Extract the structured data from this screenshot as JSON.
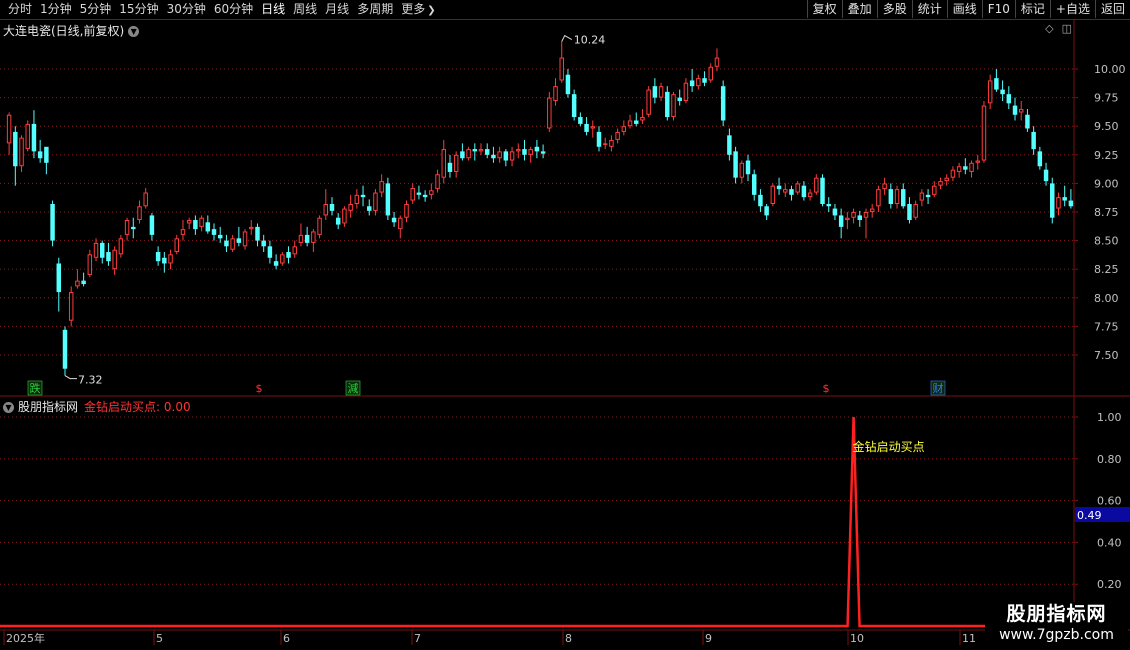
{
  "toolbar": {
    "tabs": [
      "分时",
      "1分钟",
      "5分钟",
      "15分钟",
      "30分钟",
      "60分钟",
      "日线",
      "周线",
      "月线",
      "多周期",
      "更多"
    ],
    "active_tab": "日线",
    "right_buttons": [
      "复权",
      "叠加",
      "多股",
      "统计",
      "画线",
      "F10",
      "标记",
      "+自选",
      "返回"
    ]
  },
  "stock_title": "大连电瓷(日线,前复权)",
  "price_axis": [
    "10.00",
    "9.75",
    "9.50",
    "9.25",
    "9.00",
    "8.75",
    "8.50",
    "8.25",
    "8.00",
    "7.75",
    "7.50"
  ],
  "annotations": {
    "high_label": "10.24",
    "low_label": "7.32"
  },
  "markers": [
    {
      "text": "跌",
      "color": "#2ecc40",
      "kind": "box"
    },
    {
      "text": "$",
      "color": "#ff3333",
      "kind": "plain"
    },
    {
      "text": "減",
      "color": "#2ecc40",
      "kind": "box"
    },
    {
      "text": "$",
      "color": "#ff3333",
      "kind": "plain"
    },
    {
      "text": "财",
      "color": "#3a78ff",
      "kind": "box"
    }
  ],
  "indicator": {
    "name": "股朋指标网",
    "label": "金钻启动买点:",
    "value": "0.00",
    "signal_text": "金钻启动买点",
    "axis": [
      "1.00",
      "0.80",
      "0.60",
      "0.40",
      "0.20"
    ],
    "current_badge": "0.49"
  },
  "date_axis": [
    "2025年",
    "5",
    "6",
    "7",
    "8",
    "9",
    "10",
    "11"
  ],
  "watermark": {
    "title": "股朋指标网",
    "url": "www.7gpzb.com"
  },
  "colors": {
    "up": "#ff3c3c",
    "down": "#54ffff",
    "grid": "#8b1a1a",
    "signal": "#ff2020",
    "text": "#c0c0c0"
  },
  "candles": [
    [
      9.35,
      9.62,
      9.25,
      9.6
    ],
    [
      9.45,
      9.5,
      8.98,
      9.15
    ],
    [
      9.15,
      9.42,
      9.1,
      9.4
    ],
    [
      9.3,
      9.55,
      9.28,
      9.52
    ],
    [
      9.52,
      9.64,
      9.22,
      9.28
    ],
    [
      9.28,
      9.38,
      9.18,
      9.22
    ],
    [
      9.32,
      9.28,
      9.08,
      9.18
    ],
    [
      8.82,
      8.85,
      8.45,
      8.5
    ],
    [
      8.3,
      8.35,
      7.88,
      8.05
    ],
    [
      7.72,
      7.75,
      7.32,
      7.38
    ],
    [
      7.8,
      8.1,
      7.75,
      8.05
    ],
    [
      8.1,
      8.25,
      8.08,
      8.15
    ],
    [
      8.15,
      8.22,
      8.1,
      8.12
    ],
    [
      8.2,
      8.42,
      8.18,
      8.38
    ],
    [
      8.35,
      8.52,
      8.32,
      8.48
    ],
    [
      8.48,
      8.5,
      8.3,
      8.35
    ],
    [
      8.4,
      8.48,
      8.28,
      8.32
    ],
    [
      8.25,
      8.45,
      8.2,
      8.42
    ],
    [
      8.38,
      8.55,
      8.35,
      8.52
    ],
    [
      8.55,
      8.7,
      8.5,
      8.68
    ],
    [
      8.62,
      8.7,
      8.52,
      8.6
    ],
    [
      8.68,
      8.85,
      8.65,
      8.8
    ],
    [
      8.8,
      8.96,
      8.78,
      8.92
    ],
    [
      8.72,
      8.74,
      8.5,
      8.55
    ],
    [
      8.4,
      8.45,
      8.28,
      8.32
    ],
    [
      8.35,
      8.4,
      8.22,
      8.3
    ],
    [
      8.3,
      8.42,
      8.25,
      8.38
    ],
    [
      8.4,
      8.55,
      8.38,
      8.52
    ],
    [
      8.55,
      8.68,
      8.5,
      8.6
    ],
    [
      8.65,
      8.7,
      8.6,
      8.68
    ],
    [
      8.68,
      8.72,
      8.55,
      8.6
    ],
    [
      8.62,
      8.72,
      8.58,
      8.7
    ],
    [
      8.66,
      8.72,
      8.56,
      8.58
    ],
    [
      8.6,
      8.65,
      8.5,
      8.55
    ],
    [
      8.55,
      8.62,
      8.48,
      8.52
    ],
    [
      8.5,
      8.55,
      8.4,
      8.45
    ],
    [
      8.42,
      8.55,
      8.4,
      8.52
    ],
    [
      8.52,
      8.62,
      8.45,
      8.48
    ],
    [
      8.45,
      8.6,
      8.42,
      8.58
    ],
    [
      8.6,
      8.68,
      8.55,
      8.62
    ],
    [
      8.62,
      8.65,
      8.45,
      8.5
    ],
    [
      8.5,
      8.55,
      8.4,
      8.45
    ],
    [
      8.45,
      8.5,
      8.3,
      8.35
    ],
    [
      8.32,
      8.38,
      8.25,
      8.28
    ],
    [
      8.3,
      8.4,
      8.28,
      8.38
    ],
    [
      8.4,
      8.45,
      8.3,
      8.35
    ],
    [
      8.38,
      8.5,
      8.35,
      8.45
    ],
    [
      8.48,
      8.65,
      8.45,
      8.55
    ],
    [
      8.55,
      8.62,
      8.45,
      8.48
    ],
    [
      8.48,
      8.6,
      8.4,
      8.58
    ],
    [
      8.55,
      8.72,
      8.52,
      8.7
    ],
    [
      8.72,
      8.95,
      8.68,
      8.82
    ],
    [
      8.82,
      8.88,
      8.72,
      8.76
    ],
    [
      8.7,
      8.74,
      8.6,
      8.64
    ],
    [
      8.65,
      8.8,
      8.62,
      8.78
    ],
    [
      8.76,
      8.9,
      8.7,
      8.82
    ],
    [
      8.82,
      8.95,
      8.78,
      8.9
    ],
    [
      8.9,
      8.98,
      8.8,
      8.88
    ],
    [
      8.8,
      8.86,
      8.72,
      8.76
    ],
    [
      8.76,
      8.95,
      8.72,
      8.92
    ],
    [
      8.92,
      9.08,
      8.88,
      9.02
    ],
    [
      9.0,
      9.05,
      8.68,
      8.72
    ],
    [
      8.7,
      8.75,
      8.62,
      8.66
    ],
    [
      8.6,
      8.72,
      8.52,
      8.7
    ],
    [
      8.7,
      8.85,
      8.66,
      8.82
    ],
    [
      8.85,
      9.0,
      8.82,
      8.96
    ],
    [
      8.92,
      8.98,
      8.86,
      8.9
    ],
    [
      8.9,
      8.94,
      8.84,
      8.88
    ],
    [
      8.9,
      9.0,
      8.86,
      8.94
    ],
    [
      8.95,
      9.12,
      8.92,
      9.08
    ],
    [
      9.05,
      9.38,
      9.0,
      9.3
    ],
    [
      9.18,
      9.25,
      9.05,
      9.1
    ],
    [
      9.1,
      9.28,
      9.05,
      9.25
    ],
    [
      9.28,
      9.35,
      9.2,
      9.22
    ],
    [
      9.22,
      9.32,
      9.2,
      9.3
    ],
    [
      9.3,
      9.35,
      9.2,
      9.28
    ],
    [
      9.28,
      9.35,
      9.25,
      9.3
    ],
    [
      9.3,
      9.35,
      9.22,
      9.25
    ],
    [
      9.25,
      9.32,
      9.18,
      9.22
    ],
    [
      9.22,
      9.32,
      9.18,
      9.28
    ],
    [
      9.28,
      9.3,
      9.15,
      9.2
    ],
    [
      9.2,
      9.32,
      9.15,
      9.28
    ],
    [
      9.28,
      9.35,
      9.22,
      9.3
    ],
    [
      9.3,
      9.38,
      9.2,
      9.25
    ],
    [
      9.25,
      9.32,
      9.18,
      9.3
    ],
    [
      9.32,
      9.38,
      9.22,
      9.28
    ],
    [
      9.28,
      9.34,
      9.22,
      9.26
    ],
    [
      9.48,
      9.8,
      9.45,
      9.75
    ],
    [
      9.72,
      9.92,
      9.68,
      9.85
    ],
    [
      9.9,
      10.24,
      9.88,
      10.1
    ],
    [
      9.95,
      10.0,
      9.75,
      9.78
    ],
    [
      9.78,
      9.82,
      9.55,
      9.58
    ],
    [
      9.58,
      9.62,
      9.5,
      9.52
    ],
    [
      9.52,
      9.58,
      9.42,
      9.45
    ],
    [
      9.48,
      9.55,
      9.4,
      9.5
    ],
    [
      9.45,
      9.5,
      9.28,
      9.32
    ],
    [
      9.35,
      9.4,
      9.3,
      9.35
    ],
    [
      9.32,
      9.42,
      9.28,
      9.38
    ],
    [
      9.38,
      9.48,
      9.35,
      9.45
    ],
    [
      9.45,
      9.55,
      9.42,
      9.5
    ],
    [
      9.5,
      9.6,
      9.48,
      9.55
    ],
    [
      9.55,
      9.62,
      9.5,
      9.52
    ],
    [
      9.55,
      9.65,
      9.52,
      9.58
    ],
    [
      9.6,
      9.85,
      9.58,
      9.82
    ],
    [
      9.85,
      9.92,
      9.7,
      9.75
    ],
    [
      9.75,
      9.88,
      9.72,
      9.85
    ],
    [
      9.8,
      9.85,
      9.55,
      9.58
    ],
    [
      9.58,
      9.8,
      9.55,
      9.78
    ],
    [
      9.75,
      9.82,
      9.68,
      9.72
    ],
    [
      9.72,
      9.92,
      9.7,
      9.88
    ],
    [
      9.9,
      10.0,
      9.8,
      9.85
    ],
    [
      9.85,
      9.95,
      9.82,
      9.92
    ],
    [
      9.92,
      9.98,
      9.85,
      9.88
    ],
    [
      9.9,
      10.05,
      9.88,
      10.02
    ],
    [
      10.02,
      10.18,
      9.98,
      10.1
    ],
    [
      9.85,
      9.9,
      9.5,
      9.55
    ],
    [
      9.42,
      9.48,
      9.2,
      9.25
    ],
    [
      9.28,
      9.32,
      9.0,
      9.05
    ],
    [
      9.05,
      9.2,
      9.0,
      9.18
    ],
    [
      9.2,
      9.25,
      9.02,
      9.08
    ],
    [
      9.08,
      9.12,
      8.85,
      8.9
    ],
    [
      8.9,
      8.95,
      8.75,
      8.8
    ],
    [
      8.8,
      8.82,
      8.68,
      8.72
    ],
    [
      8.82,
      9.0,
      8.8,
      8.98
    ],
    [
      8.98,
      9.05,
      8.9,
      8.95
    ],
    [
      8.92,
      9.0,
      8.88,
      8.95
    ],
    [
      8.95,
      8.98,
      8.85,
      8.9
    ],
    [
      8.92,
      9.02,
      8.9,
      9.0
    ],
    [
      8.98,
      9.02,
      8.85,
      8.88
    ],
    [
      8.88,
      8.95,
      8.85,
      8.92
    ],
    [
      8.92,
      9.08,
      8.9,
      9.05
    ],
    [
      9.05,
      9.08,
      8.8,
      8.82
    ],
    [
      8.82,
      8.88,
      8.75,
      8.8
    ],
    [
      8.78,
      8.82,
      8.68,
      8.72
    ],
    [
      8.72,
      8.78,
      8.52,
      8.62
    ],
    [
      8.68,
      8.75,
      8.6,
      8.7
    ],
    [
      8.7,
      8.78,
      8.65,
      8.75
    ],
    [
      8.72,
      8.76,
      8.62,
      8.68
    ],
    [
      8.7,
      8.78,
      8.52,
      8.75
    ],
    [
      8.75,
      8.82,
      8.7,
      8.78
    ],
    [
      8.8,
      8.98,
      8.75,
      8.95
    ],
    [
      8.95,
      9.05,
      8.9,
      9.0
    ],
    [
      8.95,
      9.0,
      8.78,
      8.82
    ],
    [
      8.82,
      8.98,
      8.78,
      8.95
    ],
    [
      8.95,
      9.0,
      8.78,
      8.8
    ],
    [
      8.82,
      8.88,
      8.65,
      8.68
    ],
    [
      8.7,
      8.85,
      8.68,
      8.82
    ],
    [
      8.85,
      8.95,
      8.8,
      8.92
    ],
    [
      8.9,
      8.95,
      8.82,
      8.88
    ],
    [
      8.9,
      9.02,
      8.88,
      8.98
    ],
    [
      8.98,
      9.05,
      8.95,
      9.02
    ],
    [
      9.02,
      9.08,
      8.98,
      9.05
    ],
    [
      9.05,
      9.15,
      9.02,
      9.12
    ],
    [
      9.1,
      9.18,
      9.05,
      9.15
    ],
    [
      9.15,
      9.22,
      9.08,
      9.12
    ],
    [
      9.1,
      9.2,
      9.05,
      9.18
    ],
    [
      9.18,
      9.25,
      9.12,
      9.2
    ],
    [
      9.2,
      9.72,
      9.18,
      9.68
    ],
    [
      9.7,
      9.95,
      9.65,
      9.9
    ],
    [
      9.92,
      10.0,
      9.8,
      9.82
    ],
    [
      9.82,
      9.9,
      9.72,
      9.78
    ],
    [
      9.78,
      9.85,
      9.65,
      9.7
    ],
    [
      9.68,
      9.75,
      9.55,
      9.6
    ],
    [
      9.62,
      9.72,
      9.55,
      9.65
    ],
    [
      9.6,
      9.65,
      9.45,
      9.48
    ],
    [
      9.45,
      9.5,
      9.25,
      9.3
    ],
    [
      9.28,
      9.32,
      9.12,
      9.15
    ],
    [
      9.12,
      9.18,
      8.98,
      9.02
    ],
    [
      9.0,
      9.05,
      8.65,
      8.7
    ],
    [
      8.78,
      8.92,
      8.72,
      8.88
    ],
    [
      8.88,
      8.98,
      8.8,
      8.85
    ],
    [
      8.85,
      8.95,
      8.78,
      8.8
    ]
  ]
}
